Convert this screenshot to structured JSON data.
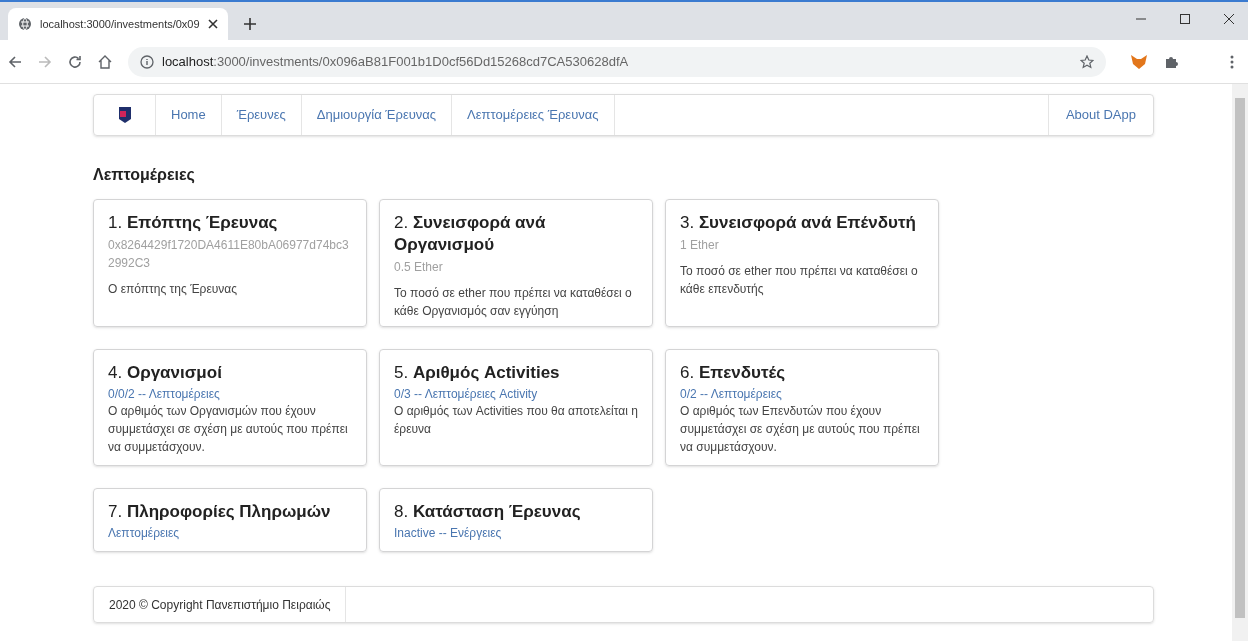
{
  "browser": {
    "tab_title": "localhost:3000/investments/0x09",
    "url_host": "localhost",
    "url_rest": ":3000/investments/0x096aB81F001b1D0cf56Dd15268cd7CA530628dfA"
  },
  "nav": {
    "items": [
      "Home",
      "Έρευνες",
      "Δημιουργία Έρευνας",
      "Λεπτομέρειες Έρευνας"
    ],
    "right_item": "About DApp"
  },
  "heading": "Λεπτομέρειες",
  "cards": [
    {
      "title": "1. **Επόπτης Έρευνας**",
      "kind": "value",
      "sub": "0x8264429f1720DA4611E80bA06977d74bc32992C3",
      "description": "Ο επόπτης της Έρευνας"
    },
    {
      "title": "2. **Συνεισφορά ανά Οργανισμού**",
      "kind": "value",
      "sub": "0.5 Ether",
      "description": "Το ποσό σε ether που πρέπει να καταθέσει ο κάθε Οργανισμός σαν εγγύηση"
    },
    {
      "title": "3. **Συνεισφορά ανά Επένδυτή**",
      "kind": "value",
      "sub": "1 Ether",
      "description": "Το ποσό σε ether που πρέπει να καταθέσει ο κάθε επενδυτής"
    },
    {
      "title": "4. **Οργανισμοί**",
      "kind": "link",
      "sub": "0/0/2 -- Λεπτομέρειες",
      "description": "Ο αρθιμός των Οργανισμών που έχουν συμμετάσχει σε σχέση με αυτούς που πρέπει να συμμετάσχουν."
    },
    {
      "title": "5. **Αριθμός Activities**",
      "kind": "link",
      "sub": "0/3 -- Λεπτομέρειες Activity",
      "description": "Ο αριθμός των Activities που θα αποτελείται η έρευνα"
    },
    {
      "title": "6. **Επενδυτές**",
      "kind": "link",
      "sub": "0/2 -- Λεπτομέρειες",
      "description": "Ο αριθμός των Επενδυτών που έχουν συμμετάσχει σε σχέση με αυτούς που πρέπει να συμμετάσχουν."
    },
    {
      "title": "7. **Πληροφορίες Πληρωμών**",
      "kind": "link",
      "sub": "Λεπτομέρειες"
    },
    {
      "title": "8. **Κατάσταση Έρευνας**",
      "kind": "link",
      "sub": "Inactive -- Ενέργειες"
    }
  ],
  "footer": "2020 © Copyright Πανεπιστήμιο Πειραιώς"
}
